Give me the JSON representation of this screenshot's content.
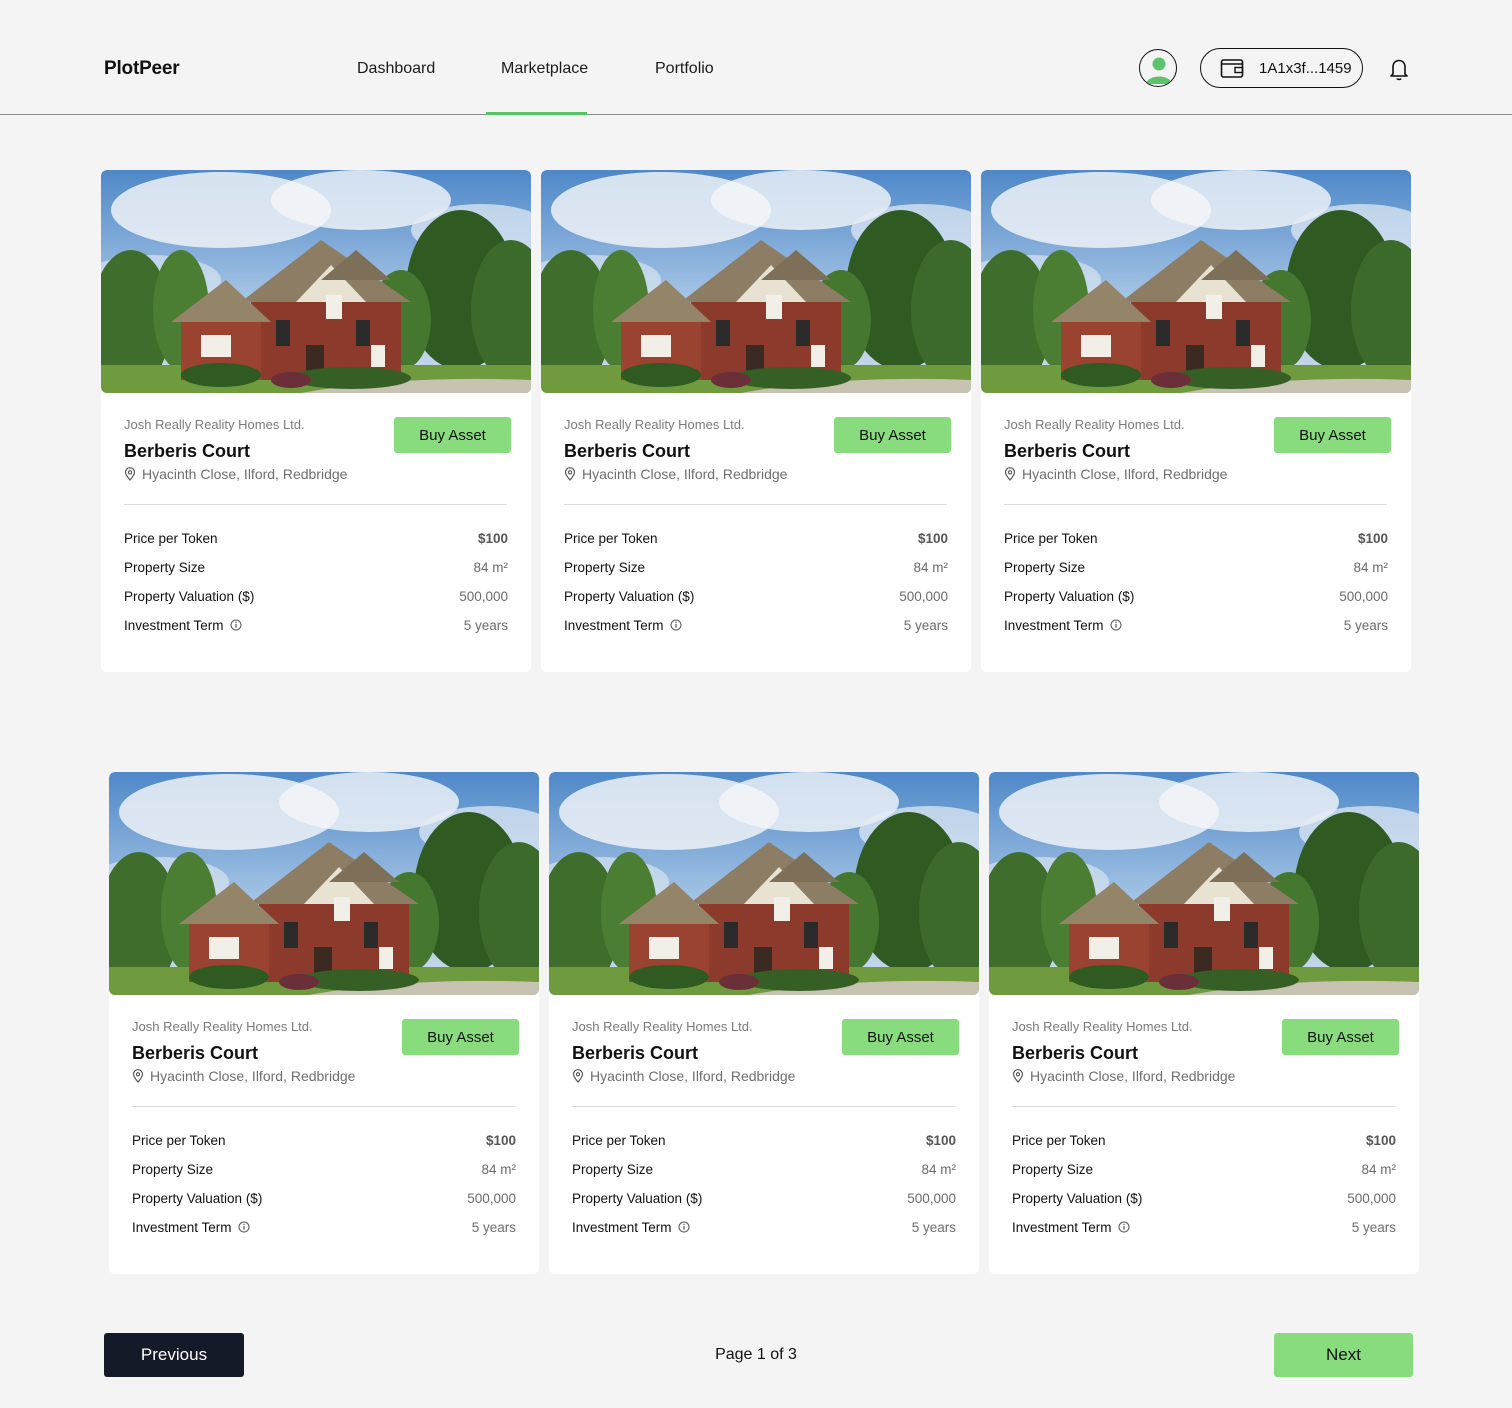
{
  "header": {
    "logo": "PlotPeer",
    "nav": [
      "Dashboard",
      "Marketplace",
      "Portfolio"
    ],
    "active_nav": "Marketplace",
    "wallet_address": "1A1x3f...1459",
    "accent_color": "#55c463"
  },
  "listings": [
    {
      "developer": "Josh Really Reality Homes Ltd.",
      "name": "Berberis Court",
      "location": "Hyacinth Close, Ilford, Redbridge",
      "buy_label": "Buy Asset",
      "price_label": "Price per Token",
      "price": "$100",
      "size_label": "Property Size",
      "size": "84 m²",
      "valuation_label": "Property Valuation ($)",
      "valuation": "500,000",
      "term_label": "Investment Term",
      "term": "5 years"
    },
    {
      "developer": "Josh Really Reality Homes Ltd.",
      "name": "Berberis Court",
      "location": "Hyacinth Close, Ilford, Redbridge",
      "buy_label": "Buy Asset",
      "price_label": "Price per Token",
      "price": "$100",
      "size_label": "Property Size",
      "size": "84 m²",
      "valuation_label": "Property Valuation ($)",
      "valuation": "500,000",
      "term_label": "Investment Term",
      "term": "5 years"
    },
    {
      "developer": "Josh Really Reality Homes Ltd.",
      "name": "Berberis Court",
      "location": "Hyacinth Close, Ilford, Redbridge",
      "buy_label": "Buy Asset",
      "price_label": "Price per Token",
      "price": "$100",
      "size_label": "Property Size",
      "size": "84 m²",
      "valuation_label": "Property Valuation ($)",
      "valuation": "500,000",
      "term_label": "Investment Term",
      "term": "5 years"
    },
    {
      "developer": "Josh Really Reality Homes Ltd.",
      "name": "Berberis Court",
      "location": "Hyacinth Close, Ilford, Redbridge",
      "buy_label": "Buy Asset",
      "price_label": "Price per Token",
      "price": "$100",
      "size_label": "Property Size",
      "size": "84 m²",
      "valuation_label": "Property Valuation ($)",
      "valuation": "500,000",
      "term_label": "Investment Term",
      "term": "5 years"
    },
    {
      "developer": "Josh Really Reality Homes Ltd.",
      "name": "Berberis Court",
      "location": "Hyacinth Close, Ilford, Redbridge",
      "buy_label": "Buy Asset",
      "price_label": "Price per Token",
      "price": "$100",
      "size_label": "Property Size",
      "size": "84 m²",
      "valuation_label": "Property Valuation ($)",
      "valuation": "500,000",
      "term_label": "Investment Term",
      "term": "5 years"
    },
    {
      "developer": "Josh Really Reality Homes Ltd.",
      "name": "Berberis Court",
      "location": "Hyacinth Close, Ilford, Redbridge",
      "buy_label": "Buy Asset",
      "price_label": "Price per Token",
      "price": "$100",
      "size_label": "Property Size",
      "size": "84 m²",
      "valuation_label": "Property Valuation ($)",
      "valuation": "500,000",
      "term_label": "Investment Term",
      "term": "5 years"
    }
  ],
  "pagination": {
    "previous_label": "Previous",
    "next_label": "Next",
    "page_text": "Page 1 of 3"
  },
  "icons": [
    "user-avatar-icon",
    "wallet-icon",
    "bell-icon",
    "location-pin-icon",
    "info-icon"
  ],
  "colors": {
    "primary_button": "#89dc7e",
    "dark_button": "#141a27"
  }
}
